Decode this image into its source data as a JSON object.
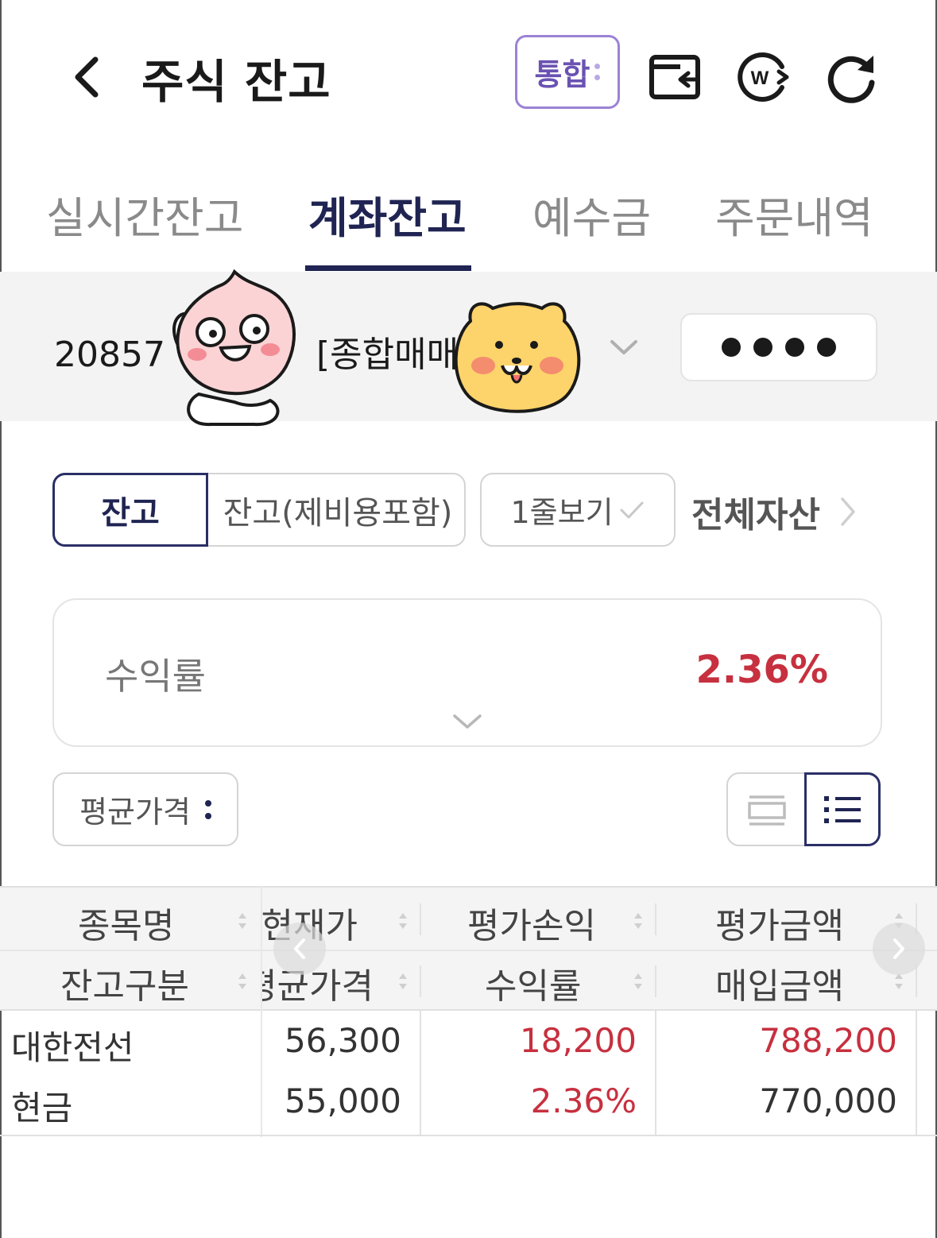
{
  "header": {
    "title": "주식 잔고",
    "integrated_label": "통합"
  },
  "tabs": [
    {
      "label": "실시간잔고",
      "active": false
    },
    {
      "label": "계좌잔고",
      "active": true
    },
    {
      "label": "예수금",
      "active": false
    },
    {
      "label": "주문내역",
      "active": false
    }
  ],
  "account": {
    "number_visible": "20857",
    "type_label": "[종합매매"
  },
  "filters": {
    "balance_label": "잔고",
    "balance_with_fees_label": "잔고(제비용포함)",
    "one_line_view_label": "1줄보기",
    "total_assets_label": "전체자산"
  },
  "summary": {
    "return_label": "수익률",
    "return_value": "2.36%"
  },
  "sort": {
    "label": "평균가격"
  },
  "table": {
    "headers_row1": [
      "종목명",
      "현재가",
      "평가손익",
      "평가금액"
    ],
    "headers_row2": [
      "잔고구분",
      "평균가격",
      "수익률",
      "매입금액"
    ],
    "rows": [
      {
        "name": "대한전선",
        "current_price": "56,300",
        "eval_pl": "18,200",
        "eval_amount": "788,200"
      },
      {
        "name": "현금",
        "current_price": "55,000",
        "eval_pl": "2.36%",
        "eval_amount": "770,000"
      }
    ]
  },
  "colors": {
    "accent_navy": "#1f2452",
    "accent_purple": "#6a52b3",
    "profit_red": "#c7303f"
  },
  "icons": [
    "back-chevron-icon",
    "wallet-transfer-icon",
    "currency-exchange-icon",
    "refresh-icon",
    "chevron-down-icon",
    "check-icon",
    "chevron-right-icon",
    "card-view-icon",
    "list-view-icon",
    "sort-arrows-icon"
  ]
}
